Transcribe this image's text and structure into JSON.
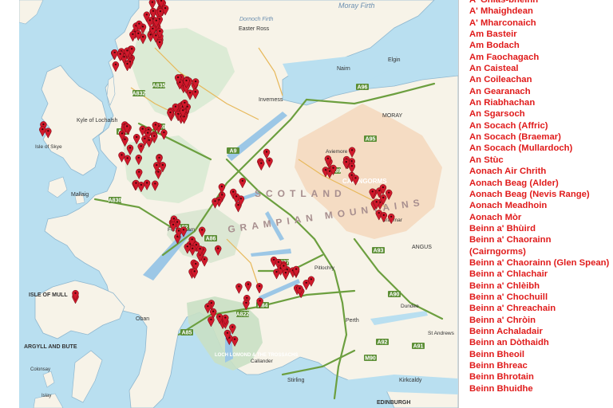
{
  "map": {
    "colors": {
      "sea": "#b9dff0",
      "land": "#f7f3e8",
      "national_park": "#c9e0c4",
      "cairngorms_park": "#f4d9bf",
      "loch": "#9cc7e6",
      "road": "#6c9f3f",
      "marker": "#d0192b"
    },
    "labels": {
      "skye": "Isle of Skye",
      "kyle": "Kyle of Lochalsh",
      "mallaig": "Mallaig",
      "mull": "ISLE OF MULL",
      "argyll": "ARGYLL AND BUTE",
      "oban": "Oban",
      "inverness": "Inverness",
      "nairn": "Nairn",
      "elgin": "Elgin",
      "moray": "MORAY",
      "perth": "Perth",
      "stirling": "Stirling",
      "kirkcaldy": "Kirkcaldy",
      "edinburgh": "EDINBURGH",
      "angus": "ANGUS",
      "cairngorms": "CAIRNGORMS",
      "trossachs": "LOCH LOMOND & THE TROSSACHS",
      "scotland": "SCOTLAND",
      "grampian": "GRAMPIAN MOUNTAINS",
      "dornoch": "Dornoch Firth",
      "easter_ross": "Easter Ross",
      "moray_firth": "Moray Firth",
      "fort_william": "Fort William",
      "pitlochry": "Pitlochry",
      "aviemore": "Aviemore",
      "braemar": "Braemar",
      "callander": "Callander",
      "dundee": "Dundee",
      "st_andrews": "St Andrews",
      "colonsay": "Colonsay",
      "islay": "Islay"
    },
    "road_numbers": [
      "A9",
      "A82",
      "A87",
      "A830",
      "A86",
      "A85",
      "A84",
      "A93",
      "A96",
      "A835",
      "A832",
      "A890",
      "A95",
      "A939",
      "A827",
      "A822",
      "A90",
      "M90",
      "A92",
      "A91"
    ],
    "marker_count": 218
  },
  "sidebar": {
    "items": [
      "A' Ghlas-bheinn",
      "A' Mhaighdean",
      "A' Mharconaich",
      "Am Basteir",
      "Am Bodach",
      "Am Faochagach",
      "An Caisteal",
      "An Coileachan",
      "An Gearanach",
      "An Riabhachan",
      "An Sgarsoch",
      "An Socach (Affric)",
      "An Socach (Braemar)",
      "An Socach (Mullardoch)",
      "An Stùc",
      "Aonach Air Chrith",
      "Aonach Beag (Alder)",
      "Aonach Beag (Nevis Range)",
      "Aonach Meadhoin",
      "Aonach Mòr",
      "Beinn a' Bhùird",
      "Beinn a' Chaorainn (Cairngorms)",
      "Beinn a' Chaorainn (Glen Spean)",
      "Beinn a' Chlachair",
      "Beinn a' Chlèibh",
      "Beinn a' Chochuill",
      "Beinn a' Chreachain",
      "Beinn a' Chròin",
      "Beinn Achaladair",
      "Beinn an Dòthaidh",
      "Beinn Bheoil",
      "Beinn Bhreac",
      "Beinn Bhrotain",
      "Beinn Bhuidhe"
    ]
  }
}
